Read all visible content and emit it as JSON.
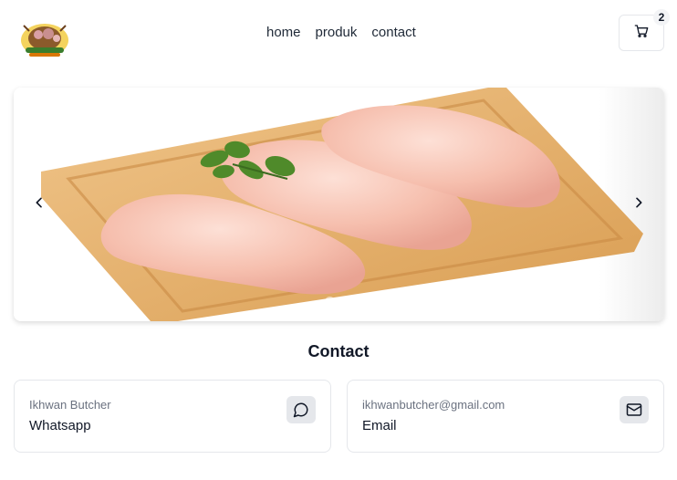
{
  "header": {
    "logo_icon": "butcher-logo-icon",
    "nav": [
      {
        "label": "home"
      },
      {
        "label": "produk"
      },
      {
        "label": "contact"
      }
    ],
    "cart": {
      "icon": "shopping-cart-icon",
      "count": "2"
    }
  },
  "carousel": {
    "prev_icon": "chevron-left-icon",
    "next_icon": "chevron-right-icon",
    "slide_count": 2,
    "active_index": 1
  },
  "contact": {
    "title": "Contact",
    "cards": [
      {
        "subtitle": "Ikhwan Butcher",
        "title": "Whatsapp",
        "icon": "chat-bubble-icon"
      },
      {
        "subtitle": "ikhwanbutcher@gmail.com",
        "title": "Email",
        "icon": "mail-icon"
      }
    ]
  },
  "colors": {
    "text": "#111827",
    "muted": "#6b7280",
    "border": "#e5e7eb",
    "board": "#e7b56c",
    "meat": "#f7c2b4"
  }
}
